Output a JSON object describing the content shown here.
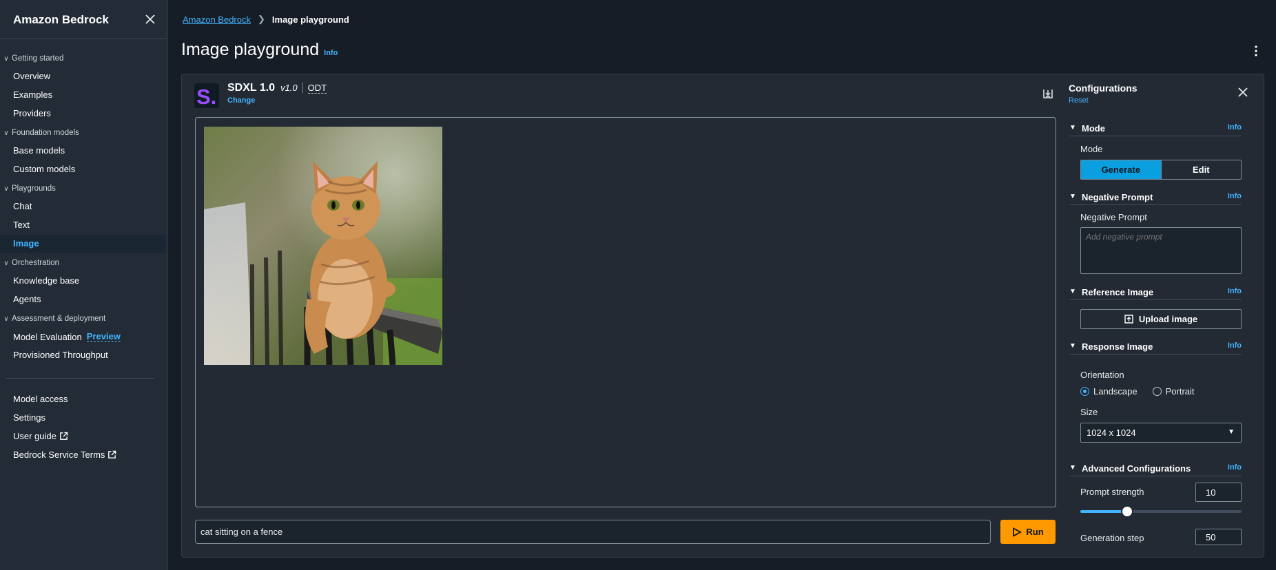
{
  "sidebar": {
    "brand": "Amazon Bedrock",
    "sections": {
      "getting_started": "Getting started",
      "foundation_models": "Foundation models",
      "playgrounds": "Playgrounds",
      "orchestration": "Orchestration",
      "assessment": "Assessment & deployment"
    },
    "items": {
      "overview": "Overview",
      "examples": "Examples",
      "providers": "Providers",
      "base_models": "Base models",
      "custom_models": "Custom models",
      "chat": "Chat",
      "text": "Text",
      "image": "Image",
      "knowledge_base": "Knowledge base",
      "agents": "Agents",
      "model_evaluation": "Model Evaluation",
      "preview_badge": "Preview",
      "provisioned_throughput": "Provisioned Throughput",
      "model_access": "Model access",
      "settings": "Settings",
      "user_guide": "User guide",
      "service_terms": "Bedrock Service Terms"
    }
  },
  "breadcrumb": {
    "root": "Amazon Bedrock",
    "current": "Image playground"
  },
  "page": {
    "title": "Image playground",
    "info": "Info"
  },
  "model": {
    "logo_text": "S.",
    "name": "SDXL 1.0",
    "version": "v1.0",
    "throughput": "ODT",
    "change": "Change"
  },
  "prompt": {
    "value": "cat sitting on a fence",
    "run_label": "Run"
  },
  "config": {
    "title": "Configurations",
    "reset": "Reset",
    "info": "Info",
    "mode": {
      "section": "Mode",
      "label": "Mode",
      "generate": "Generate",
      "edit": "Edit"
    },
    "negative": {
      "section": "Negative Prompt",
      "label": "Negative Prompt",
      "placeholder": "Add negative prompt"
    },
    "reference": {
      "section": "Reference Image",
      "upload": "Upload image"
    },
    "response": {
      "section": "Response Image",
      "orientation": "Orientation",
      "landscape": "Landscape",
      "portrait": "Portrait",
      "size_label": "Size",
      "size_value": "1024 x 1024"
    },
    "advanced": {
      "section": "Advanced Configurations",
      "prompt_strength_label": "Prompt strength",
      "prompt_strength": "10",
      "prompt_strength_fraction": 0.29,
      "generation_step_label": "Generation step",
      "generation_step": "50"
    }
  },
  "colors": {
    "accent": "#42b4ff",
    "run": "#ff9900",
    "selected_segment": "#0aa0e0"
  }
}
